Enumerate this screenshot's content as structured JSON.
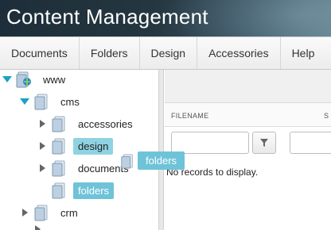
{
  "header": {
    "title": "Content Management"
  },
  "menu": {
    "items": [
      {
        "label": "Documents"
      },
      {
        "label": "Folders"
      },
      {
        "label": "Design"
      },
      {
        "label": "Accessories"
      },
      {
        "label": "Help"
      }
    ]
  },
  "tree": {
    "nodes": [
      {
        "label": "www",
        "icon": "globe-folder-icon",
        "expanded": true
      },
      {
        "label": "cms",
        "icon": "folder-icon",
        "expanded": true
      },
      {
        "label": "accessories",
        "icon": "folder-icon",
        "expanded": false
      },
      {
        "label": "design",
        "icon": "folder-icon",
        "expanded": false,
        "state": "selected"
      },
      {
        "label": "documents",
        "icon": "folder-icon",
        "expanded": false
      },
      {
        "label": "folders",
        "icon": "folder-icon",
        "state": "active"
      },
      {
        "label": "crm",
        "icon": "folder-icon",
        "expanded": false
      }
    ]
  },
  "drag": {
    "label": "folders",
    "icon": "folder-icon"
  },
  "grid": {
    "columns": [
      "FILENAME",
      "S"
    ],
    "empty_message": "No records to display.",
    "filter_icon": "filter-icon"
  },
  "colors": {
    "accent": "#1aa3c5",
    "selection": "#8fd3e3",
    "active": "#6ec3d8"
  }
}
